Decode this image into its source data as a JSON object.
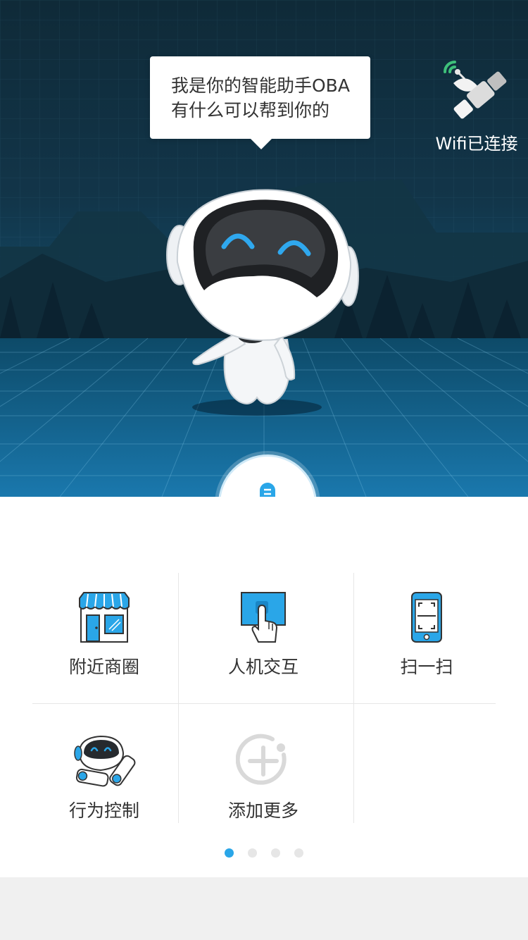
{
  "assistant": {
    "speech_line1": "我是你的智能助手OBA",
    "speech_line2": "有什么可以帮到你的"
  },
  "status": {
    "wifi_label": "Wifi已连接",
    "icon": "satellite-icon"
  },
  "voice": {
    "icon": "microphone-icon"
  },
  "grid": {
    "items": [
      {
        "label": "附近商圈",
        "icon": "store-icon"
      },
      {
        "label": "人机交互",
        "icon": "touch-screen-icon"
      },
      {
        "label": "扫一扫",
        "icon": "phone-scan-icon"
      },
      {
        "label": "行为控制",
        "icon": "robot-icon"
      },
      {
        "label": "添加更多",
        "icon": "add-more-icon"
      }
    ]
  },
  "pager": {
    "pages": 4,
    "current": 1
  },
  "colors": {
    "accent": "#2aa6e8",
    "hero_dark": "#0f2a38",
    "hero_light": "#166a95"
  }
}
